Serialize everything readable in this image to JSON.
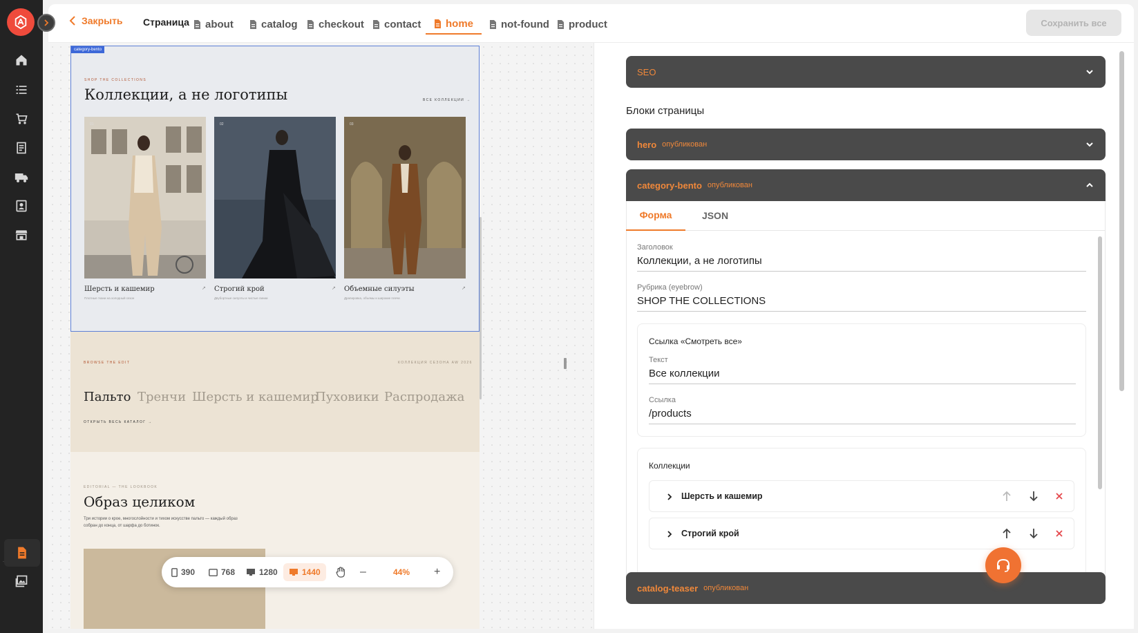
{
  "topbar": {
    "close_label": "Закрыть",
    "page_label": "Страница",
    "tabs": [
      {
        "label": "about"
      },
      {
        "label": "catalog"
      },
      {
        "label": "checkout"
      },
      {
        "label": "contact"
      },
      {
        "label": "home",
        "active": true
      },
      {
        "label": "not-found"
      },
      {
        "label": "product"
      }
    ],
    "save_label": "Сохранить все"
  },
  "sidebar": {
    "items": [
      "home-icon",
      "list-icon",
      "cart-icon",
      "orders-icon",
      "truck-icon",
      "contacts-icon",
      "store-icon",
      "pages-icon",
      "media-icon"
    ],
    "active": "pages-icon"
  },
  "preview": {
    "section_tag": "category-bento",
    "bento": {
      "eyebrow": "SHOP THE COLLECTIONS",
      "title": "Коллекции, а не логотипы",
      "view_all": "ВСЕ КОЛЛЕКЦИИ →",
      "cards": [
        {
          "num": "01",
          "title": "Шерсть и кашемир",
          "sub": "Плотные ткани на холодный сезон"
        },
        {
          "num": "02",
          "title": "Строгий крой",
          "sub": "Двубортные силуэты и чистые линии"
        },
        {
          "num": "03",
          "title": "Объемные силуэты",
          "sub": "Драпировка, объемы и широкие плечи"
        }
      ]
    },
    "edit": {
      "eyebrow": "BROWSE THE EDIT",
      "season": "КОЛЛЕКЦИЯ СЕЗОНА AW 2026",
      "categories": [
        "Пальто",
        "Тренчи",
        "Шерсть и кашемир",
        "Пуховики",
        "Распродажа"
      ],
      "catalog_link": "ОТКРЫТЬ ВЕСЬ КАТАЛОГ →"
    },
    "lookbook": {
      "eyebrow": "EDITORIAL — THE LOOKBOOK",
      "title": "Образ целиком",
      "text_line1": "Три истории о крое, многослойности и тихом искусстве пальто — каждый образ",
      "text_line2": "собран до конца, от шарфа до ботинок."
    }
  },
  "zoom": {
    "breakpoints": [
      {
        "value": "390",
        "icon": "phone-icon"
      },
      {
        "value": "768",
        "icon": "tablet-icon"
      },
      {
        "value": "1280",
        "icon": "laptop-icon"
      },
      {
        "value": "1440",
        "icon": "desktop-icon",
        "active": true
      }
    ],
    "minus": "–",
    "level": "44%",
    "plus": "+"
  },
  "panel": {
    "seo_label": "SEO",
    "blocks_title": "Блоки страницы",
    "blocks": [
      {
        "name": "hero",
        "status": "опубликован",
        "expanded": false
      },
      {
        "name": "category-bento",
        "status": "опубликован",
        "expanded": true
      },
      {
        "name": "catalog-teaser",
        "status": "опубликован",
        "expanded": false
      }
    ],
    "tabs": [
      "Форма",
      "JSON"
    ],
    "form": {
      "title_label": "Заголовок",
      "title_value": "Коллекции, а не логотипы",
      "eyebrow_label": "Рубрика (eyebrow)",
      "eyebrow_value": "SHOP THE COLLECTIONS",
      "link_group_title": "Ссылка «Смотреть все»",
      "text_label": "Текст",
      "text_value": "Все коллекции",
      "url_label": "Ссылка",
      "url_value": "/products",
      "collections_title": "Коллекции",
      "collections": [
        "Шерсть и кашемир",
        "Строгий крой"
      ]
    }
  },
  "colors": {
    "accent": "#ef7a2a",
    "dark": "#4a4a4a",
    "rail": "#232323",
    "selection": "#3d68d8",
    "danger": "#e5484d"
  }
}
